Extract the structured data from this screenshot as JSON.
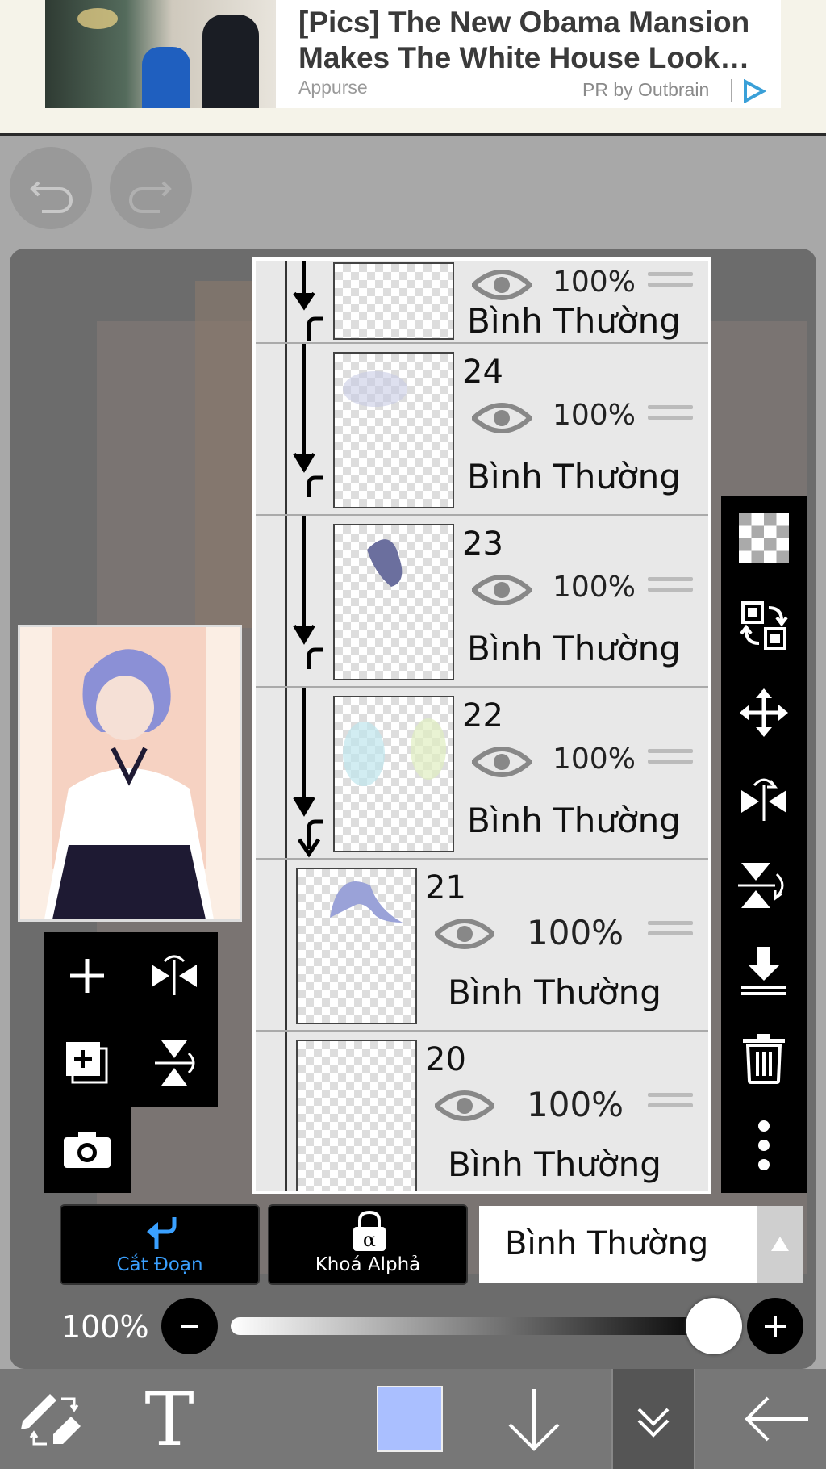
{
  "ad": {
    "title": "[Pics] The New Obama Mansion Makes The White House Look…",
    "source": "Appurse",
    "pr_label": "PR by Outbrain"
  },
  "toolbar_top": {
    "undo_icon": "undo-icon",
    "redo_icon": "redo-icon"
  },
  "layers": {
    "items": [
      {
        "number": "",
        "opacity": "100%",
        "mode": "Bình Thường",
        "clipped": true
      },
      {
        "number": "24",
        "opacity": "100%",
        "mode": "Bình Thường",
        "clipped": true
      },
      {
        "number": "23",
        "opacity": "100%",
        "mode": "Bình Thường",
        "clipped": true
      },
      {
        "number": "22",
        "opacity": "100%",
        "mode": "Bình Thường",
        "clipped": true
      },
      {
        "number": "21",
        "opacity": "100%",
        "mode": "Bình Thường",
        "clipped": false
      },
      {
        "number": "20",
        "opacity": "100%",
        "mode": "Bình Thường",
        "clipped": false
      }
    ]
  },
  "layer_controls": {
    "clip_label": "Cắt Đoạn",
    "alpha_lock_label": "Khoá Alphả",
    "blend_mode": "Bình Thường",
    "opacity_label": "100%",
    "opacity_value": 1.0
  },
  "colors": {
    "current_color": "#aabfff",
    "accent": "#3aa0ff"
  }
}
